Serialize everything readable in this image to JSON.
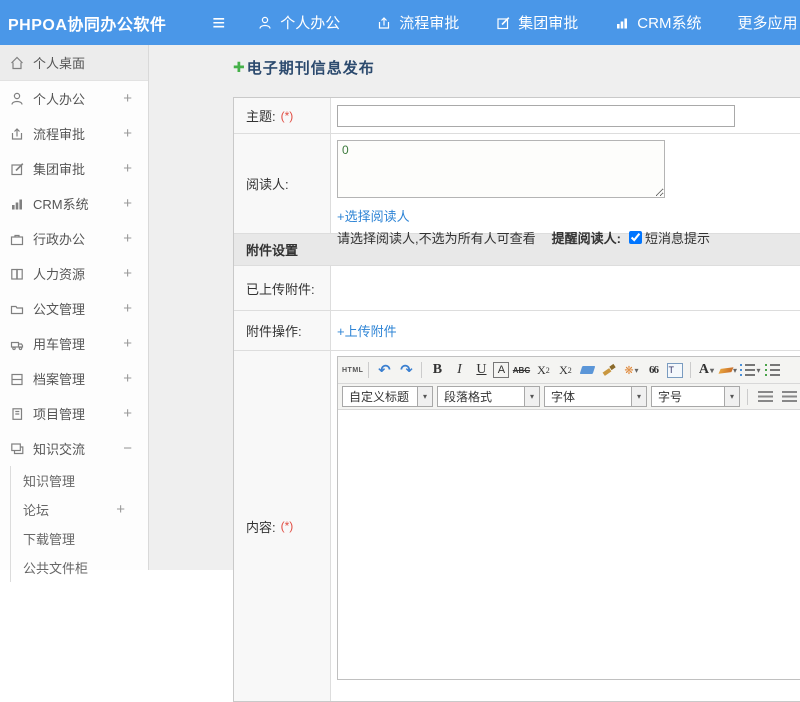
{
  "header": {
    "app_title": "PHPOA协同办公软件",
    "nav": [
      {
        "label": "个人办公"
      },
      {
        "label": "流程审批"
      },
      {
        "label": "集团审批"
      },
      {
        "label": "CRM系统"
      },
      {
        "label": "更多应用"
      }
    ]
  },
  "icons": {
    "hamburger": "≡",
    "caret_down": "▼",
    "dropdown_caret": "▾",
    "plus_green": "✚",
    "undo": "↶",
    "redo": "↷",
    "link": "⚭",
    "unlink": "⚮"
  },
  "sidebar": {
    "items": [
      {
        "label": "个人桌面",
        "expand": ""
      },
      {
        "label": "个人办公",
        "expand": "+"
      },
      {
        "label": "流程审批",
        "expand": "+"
      },
      {
        "label": "集团审批",
        "expand": "+"
      },
      {
        "label": "CRM系统",
        "expand": "+"
      },
      {
        "label": "行政办公",
        "expand": "+"
      },
      {
        "label": "人力资源",
        "expand": "+"
      },
      {
        "label": "公文管理",
        "expand": "+"
      },
      {
        "label": "用车管理",
        "expand": "+"
      },
      {
        "label": "档案管理",
        "expand": "+"
      },
      {
        "label": "项目管理",
        "expand": "+"
      },
      {
        "label": "知识交流",
        "expand": "−"
      }
    ],
    "subitems": [
      {
        "label": "知识管理",
        "expand": ""
      },
      {
        "label": "论坛",
        "expand": "+"
      },
      {
        "label": "下载管理",
        "expand": ""
      },
      {
        "label": "公共文件柜",
        "expand": ""
      }
    ]
  },
  "main": {
    "page_title": "电子期刊信息发布",
    "form": {
      "subject_label": "主题:",
      "required_mark": "(*)",
      "readers_label": "阅读人:",
      "readers_value": "0",
      "select_readers_link": "+选择阅读人",
      "readers_hint": "请选择阅读人,不选为所有人可查看",
      "remind_label": "提醒阅读人:",
      "sms_checkbox_label": "短消息提示",
      "attachments_section_title": "附件设置",
      "uploaded_attachments_label": "已上传附件:",
      "attachment_actions_label": "附件操作:",
      "upload_attachment_link": "+上传附件",
      "content_label": "内容:"
    },
    "editor": {
      "buttons": {
        "html": "HTML",
        "bold": "B",
        "italic": "I",
        "underline": "U",
        "font_box": "A",
        "strikethrough": "ABC",
        "sup_base": "X",
        "sup_exp": "2",
        "sub_base": "X",
        "sub_idx": "2",
        "quote": "66",
        "paste": "T",
        "font_color": "A"
      },
      "dropdowns": [
        {
          "label": "自定义标题"
        },
        {
          "label": "段落格式"
        },
        {
          "label": "字体"
        },
        {
          "label": "字号"
        }
      ]
    }
  }
}
